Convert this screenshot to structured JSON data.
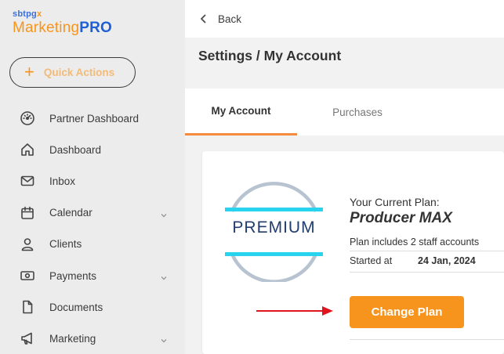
{
  "brand": {
    "top_text": "sbtpg",
    "top_x": "x",
    "main_text": "Marketing",
    "main_bold": "PRO",
    "primary_color": "#f7941d",
    "secondary_color": "#1f5fd1"
  },
  "quick_actions": {
    "plus": "+",
    "label": "Quick Actions"
  },
  "sidebar": {
    "items": [
      {
        "label": "Partner Dashboard",
        "icon": "gauge-icon",
        "has_chevron": false
      },
      {
        "label": "Dashboard",
        "icon": "home-icon",
        "has_chevron": false
      },
      {
        "label": "Inbox",
        "icon": "mail-icon",
        "has_chevron": false
      },
      {
        "label": "Calendar",
        "icon": "calendar-icon",
        "has_chevron": true
      },
      {
        "label": "Clients",
        "icon": "user-icon",
        "has_chevron": false
      },
      {
        "label": "Payments",
        "icon": "cash-icon",
        "has_chevron": true
      },
      {
        "label": "Documents",
        "icon": "document-icon",
        "has_chevron": false
      },
      {
        "label": "Marketing",
        "icon": "megaphone-icon",
        "has_chevron": true
      }
    ]
  },
  "topbar": {
    "back_label": "Back"
  },
  "page": {
    "title": "Settings / My Account"
  },
  "tabs": [
    {
      "label": "My Account",
      "active": true
    },
    {
      "label": "Purchases",
      "active": false
    }
  ],
  "plan": {
    "badge_text": "PREMIUM",
    "caption": "Your Current Plan:",
    "name": "Producer MAX",
    "staff": "Plan includes 2 staff accounts",
    "started_label": "Started at",
    "started_value": "24 Jan, 2024",
    "change_button": "Change Plan"
  },
  "colors": {
    "accent": "#f7941d",
    "tab_underline": "#f58b3c",
    "badge_ring": "#b7c3d0",
    "badge_bar": "#28d3ee",
    "arrow": "#e0141e"
  }
}
